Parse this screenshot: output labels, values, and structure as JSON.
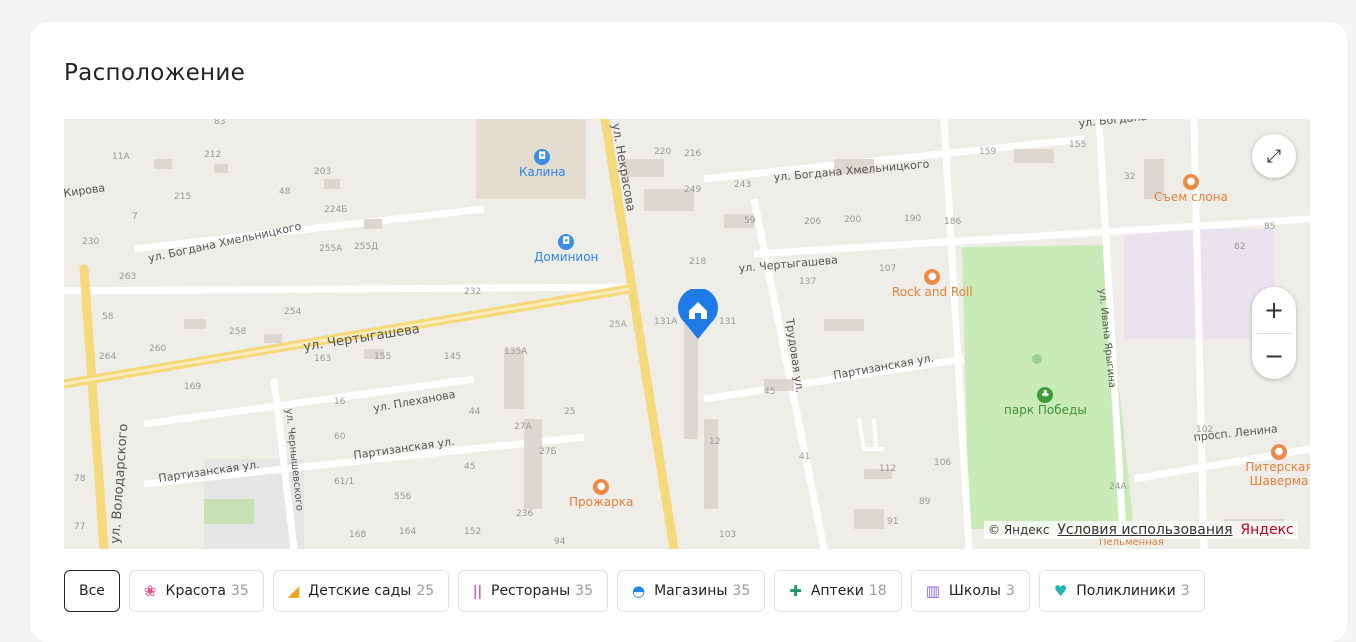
{
  "section_title": "Расположение",
  "map": {
    "streets": [
      "ул. Чертыгашева",
      "ул. Чертыгашева",
      "ул. Богдана Хмельницкого",
      "ул. Богдана Хмельницкого",
      "ул. Плеханова",
      "Партизанская ул.",
      "Партизанская ул.",
      "Партизанская ул.",
      "ул. Некрасова",
      "ул. Володарского",
      "ул. Чернышевского",
      "Трудовая ул.",
      "ул. Ивана Ярыгина",
      "просп. Ленина",
      "Кирова",
      "ул. Богдана"
    ],
    "pois": [
      "Калина",
      "Доминион",
      "Rock and Roll",
      "Съем слона",
      "парк Победы",
      "Прожарка",
      "Питерская Шаверма",
      "Пельменная"
    ],
    "house_numbers": [
      "83",
      "11А",
      "212",
      "203",
      "215",
      "48",
      "224Б",
      "7",
      "230",
      "255А",
      "255Д",
      "263",
      "254",
      "232",
      "58",
      "258",
      "260",
      "264",
      "155",
      "163",
      "145",
      "135А",
      "16",
      "169",
      "44",
      "27А",
      "25",
      "60",
      "27Б",
      "45",
      "61/1",
      "556",
      "236",
      "164",
      "168",
      "152",
      "94",
      "78",
      "77",
      "220",
      "216",
      "249",
      "243",
      "59",
      "206",
      "200",
      "190",
      "186",
      "159",
      "155",
      "32",
      "85",
      "82",
      "218",
      "137",
      "107",
      "131А",
      "131",
      "25А",
      "45",
      "12",
      "41",
      "112",
      "106",
      "89",
      "91",
      "103",
      "24А",
      "102",
      "59"
    ],
    "copyright_text": "© Яндекс",
    "terms_text": "Условия использования",
    "yandex_logo": "Яндекс",
    "zoom_in": "+",
    "zoom_out": "−",
    "expand_icon": "expand-icon"
  },
  "filters": [
    {
      "label": "Все",
      "count": "",
      "icon": "",
      "active": true
    },
    {
      "label": "Красота",
      "count": "35",
      "icon": "lotus-icon",
      "color": "#e4508b"
    },
    {
      "label": "Детские сады",
      "count": "25",
      "icon": "slide-icon",
      "color": "#f2a122"
    },
    {
      "label": "Рестораны",
      "count": "35",
      "icon": "cutlery-icon",
      "color": "#e24ec2"
    },
    {
      "label": "Магазины",
      "count": "35",
      "icon": "basket-icon",
      "color": "#1e88e5"
    },
    {
      "label": "Аптеки",
      "count": "18",
      "icon": "pharmacy-icon",
      "color": "#1f9a6a"
    },
    {
      "label": "Школы",
      "count": "3",
      "icon": "books-icon",
      "color": "#8c62e0"
    },
    {
      "label": "Поликлиники",
      "count": "3",
      "icon": "heart-icon",
      "color": "#1fb5b0"
    }
  ]
}
